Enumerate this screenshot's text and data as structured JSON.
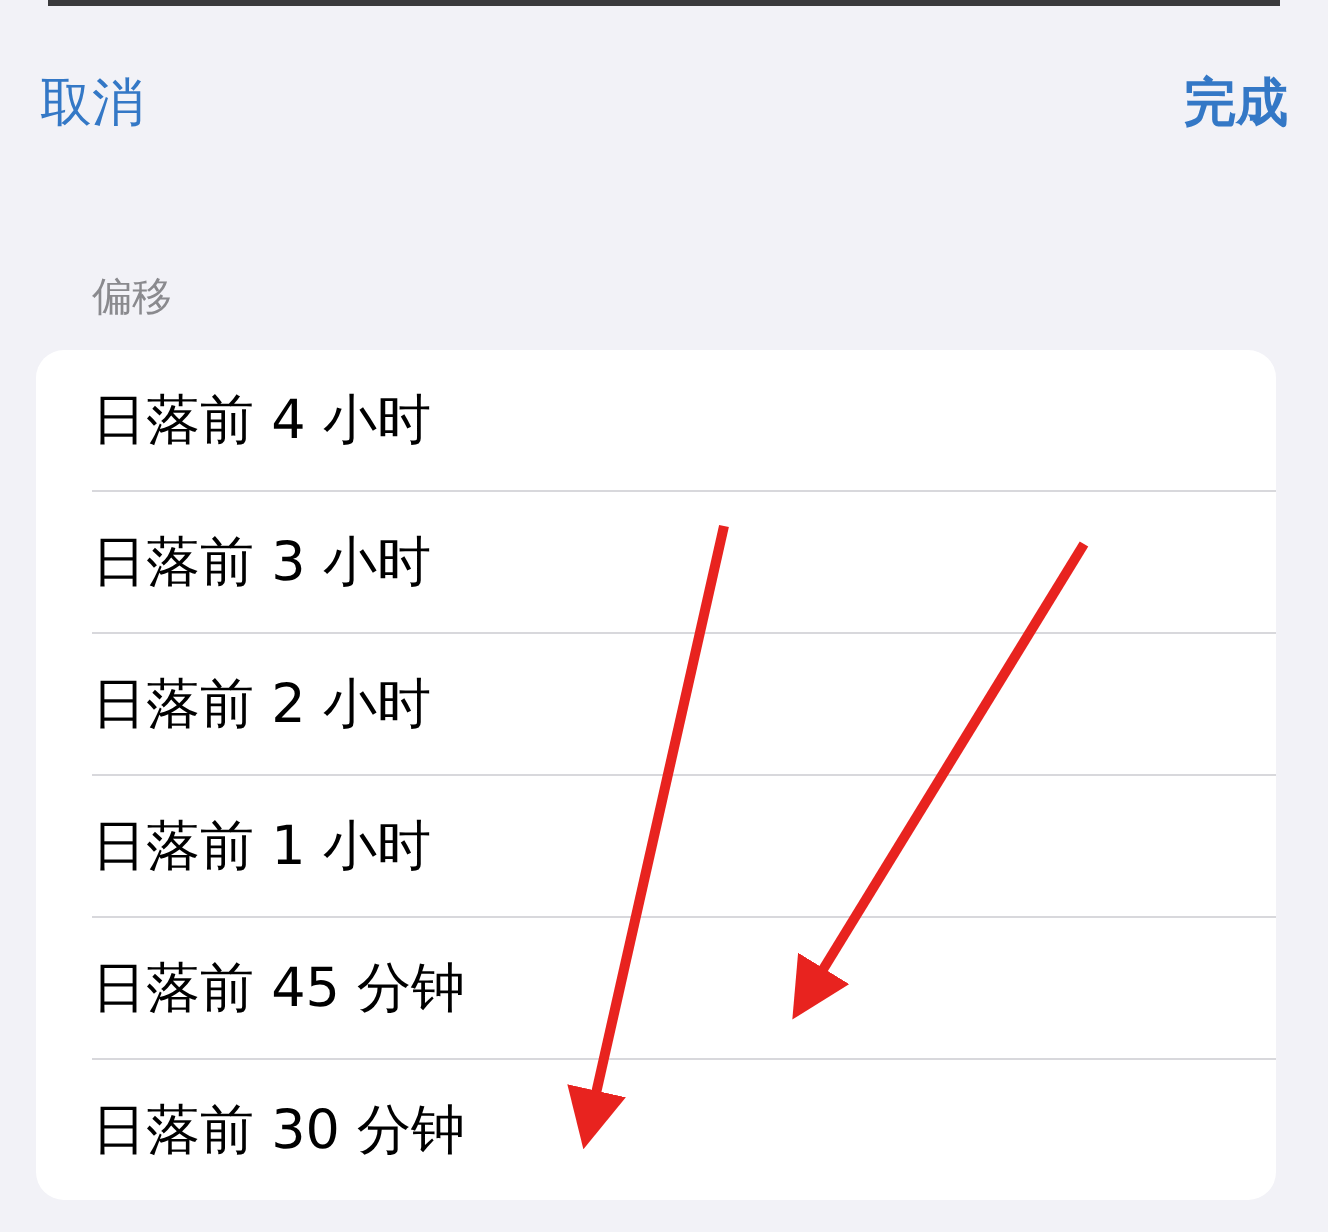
{
  "nav": {
    "cancel": "取消",
    "done": "完成"
  },
  "section_header": "偏移",
  "options": [
    {
      "label": "日落前 4 小时"
    },
    {
      "label": "日落前 3 小时"
    },
    {
      "label": "日落前 2 小时"
    },
    {
      "label": "日落前 1 小时"
    },
    {
      "label": "日落前 45 分钟"
    },
    {
      "label": "日落前 30 分钟"
    }
  ]
}
